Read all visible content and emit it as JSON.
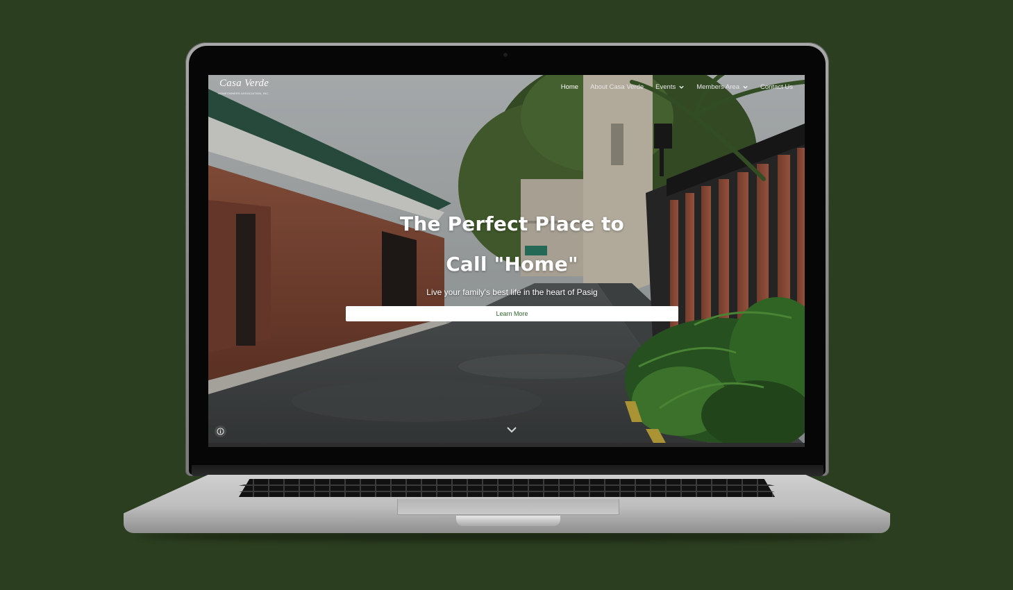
{
  "site": {
    "logo_title": "Casa Verde",
    "logo_subtitle": "HOMEOWNERS ASSOCIATION, INC."
  },
  "nav": {
    "items": [
      {
        "label": "Home",
        "active": true,
        "dropdown": false
      },
      {
        "label": "About Casa Verde",
        "active": false,
        "dropdown": false
      },
      {
        "label": "Events",
        "active": false,
        "dropdown": true
      },
      {
        "label": "Members Area",
        "active": false,
        "dropdown": true
      },
      {
        "label": "Contact Us",
        "active": false,
        "dropdown": false
      }
    ]
  },
  "hero": {
    "title_line1": "The Perfect Place to",
    "title_line2": "Call \"Home\"",
    "subtitle": "Live your family's best life in the heart of Pasig",
    "button_label": "Learn More"
  },
  "icons": {
    "info": "info-icon",
    "scroll": "chevron-down-icon",
    "dropdown": "chevron-down-icon"
  },
  "colors": {
    "background": "#2b3e1f",
    "button_text": "#2f6a2f",
    "button_bg": "#ffffff"
  }
}
